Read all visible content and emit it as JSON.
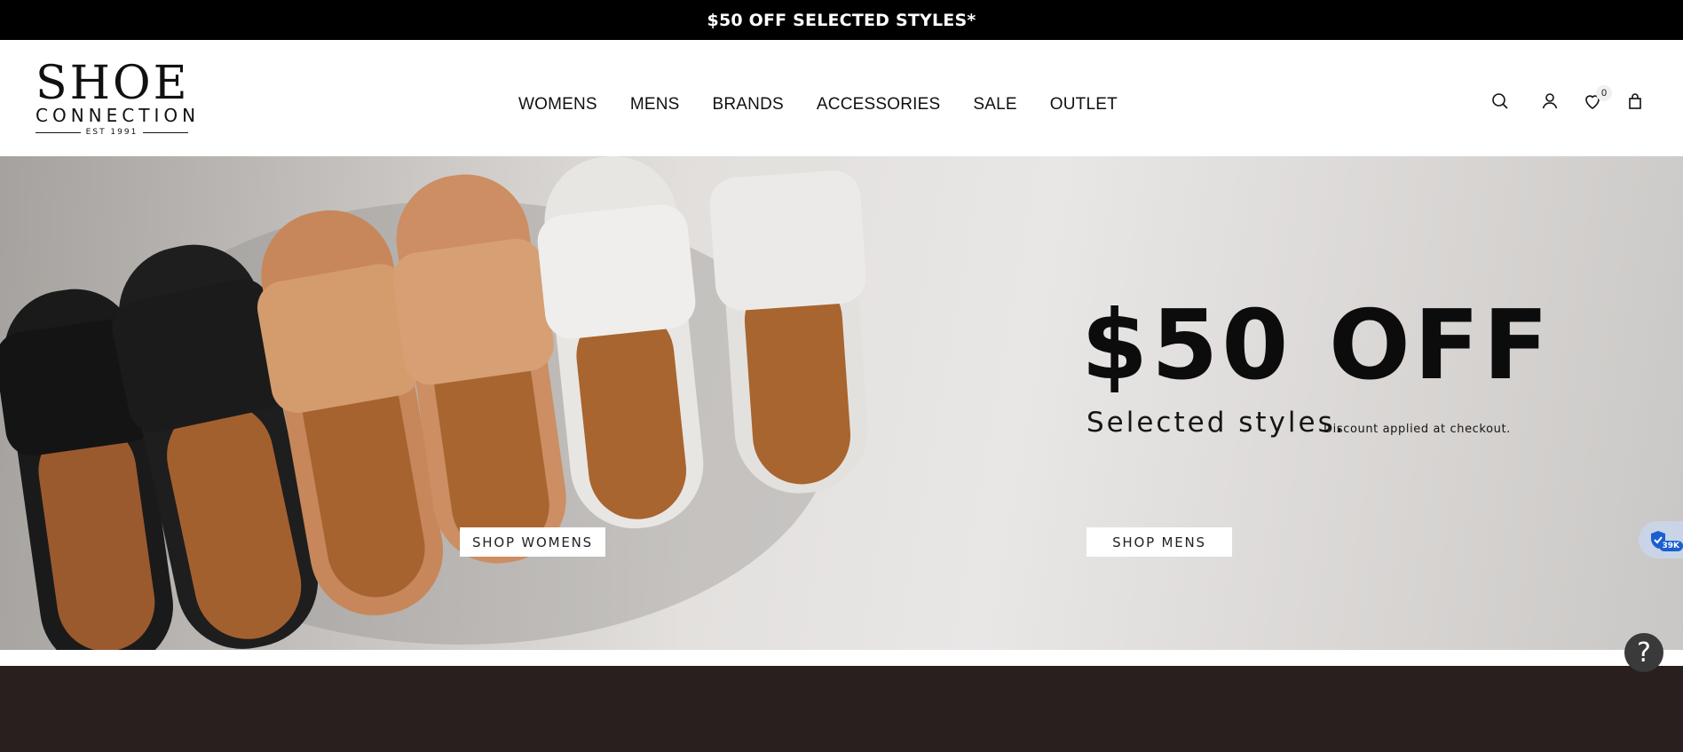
{
  "announcement": {
    "text": "$50 OFF SELECTED STYLES*"
  },
  "logo": {
    "line1": "SHOE",
    "line2": "CONNECTION",
    "line3": "EST 1991"
  },
  "nav": {
    "items": [
      {
        "label": "WOMENS"
      },
      {
        "label": "MENS"
      },
      {
        "label": "BRANDS"
      },
      {
        "label": "ACCESSORIES"
      },
      {
        "label": "SALE"
      },
      {
        "label": "OUTLET"
      }
    ]
  },
  "header_icons": {
    "search": "search-icon",
    "account": "user-icon",
    "wishlist": "heart-icon",
    "wishlist_count": "0",
    "cart": "bag-icon"
  },
  "hero": {
    "title": "$50 OFF",
    "subtitle": "Selected styles.",
    "note": "Discount applied at checkout.",
    "shop_women": "SHOP WOMENS",
    "shop_men": "SHOP MENS"
  },
  "widgets": {
    "shield_badge": "39K",
    "help_label": "?"
  },
  "colors": {
    "announcement_bg": "#000000",
    "footer_band": "#2a1f1f",
    "accent": "#1a5fd1"
  }
}
